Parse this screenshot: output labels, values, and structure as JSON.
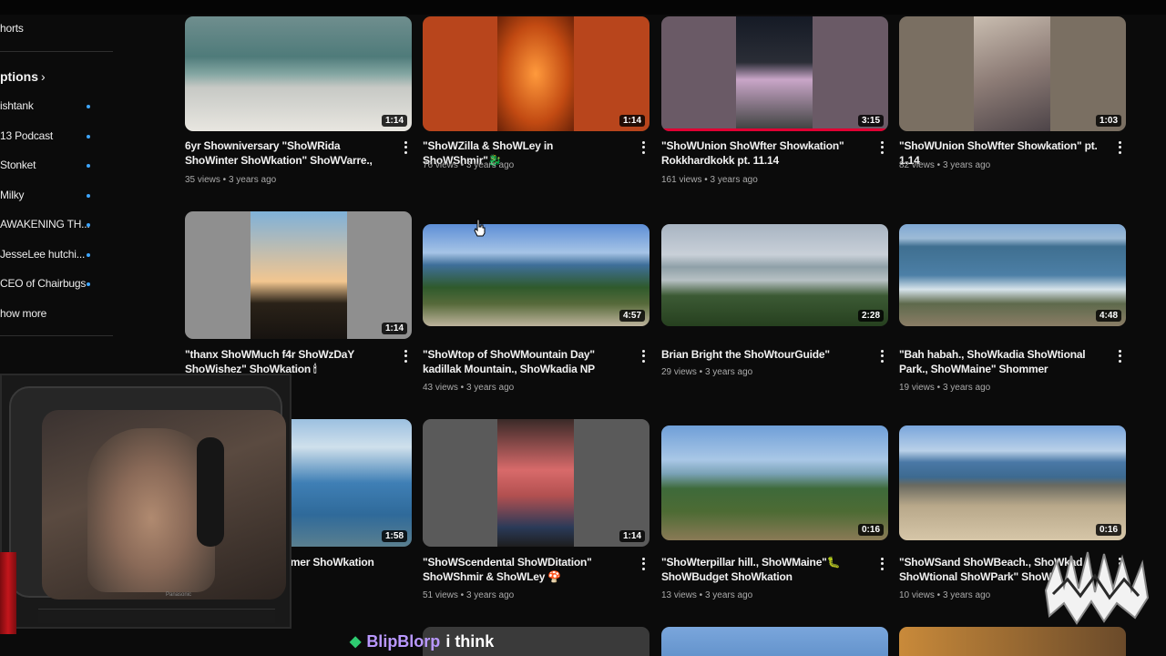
{
  "sidebar": {
    "shorts_label": "horts",
    "subscriptions_heading": "ptions",
    "channels": [
      {
        "label": "ishtank"
      },
      {
        "label": "13 Podcast"
      },
      {
        "label": "Stonket"
      },
      {
        "label": "Milky"
      },
      {
        "label": "AWAKENING TH..."
      },
      {
        "label": "JesseLee hutchi..."
      },
      {
        "label": "CEO of Chairbugs"
      }
    ],
    "show_more_label": "how more",
    "accent_color": "#3ea6ff"
  },
  "videos": [
    {
      "title": "6yr Showniversary \"ShoWRida ShoWinter ShoWkation\" ShoWVarre., ShoWBeach fM...",
      "views": "35 views",
      "age": "3 years ago",
      "duration": "1:14"
    },
    {
      "title": "\"ShoWZilla & ShoWLey in ShoWShmir\"🐉",
      "views": "76 views",
      "age": "3 years ago",
      "duration": "1:14"
    },
    {
      "title": "\"ShoWUnion ShoWfter Showkation\" Rokkhardkokk pt. 11.14",
      "views": "161 views",
      "age": "3 years ago",
      "duration": "3:15",
      "watched_fraction": 1.0
    },
    {
      "title": "\"ShoWUnion ShoWfter Showkation\" pt. 1.14",
      "views": "82 views",
      "age": "3 years ago",
      "duration": "1:03"
    },
    {
      "title": "\"thanx ShoWMuch f4r ShoWzDaY ShoWishez\" ShoWkation 🕯",
      "views": "",
      "age": "",
      "duration": "1:14"
    },
    {
      "title": "\"ShoWtop of ShoWMountain Day\" kadillak Mountain., ShoWkadia NP ShoWMaine...",
      "views": "43 views",
      "age": "3 years ago",
      "duration": "4:57"
    },
    {
      "title": "Brian Bright the ShoWtourGuide\"",
      "views": "29 views",
      "age": "3 years ago",
      "duration": "2:28"
    },
    {
      "title": "\"Bah habah., ShoWkadia ShoWtional Park., ShoWMaine\" Shommer ShoWkation fMMS...",
      "views": "19 views",
      "age": "3 years ago",
      "duration": "4:48"
    },
    {
      "title": "l P.rk., ShoWMaine mmer ShoWkation",
      "views": "",
      "age": "",
      "duration": "1:58"
    },
    {
      "title": "\"ShoWScendental ShoWDitation\" ShoWShmir & ShoWLey 🍄",
      "views": "51 views",
      "age": "3 years ago",
      "duration": "1:14"
    },
    {
      "title": "\"ShoWterpillar hill., ShoWMaine\"🐛 ShoWBudget ShoWkation",
      "views": "13 views",
      "age": "3 years ago",
      "duration": "0:16"
    },
    {
      "title": "\"ShoWSand ShoWBeach., ShoWkad ShoWtional ShoWPark\" ShoWE",
      "views": "10 views",
      "age": "3 years ago",
      "duration": "0:16"
    }
  ],
  "overlay": {
    "tv_brand": "Panasonic",
    "chat_user": "BlipBlorp",
    "chat_message": "i think",
    "chat_user_color": "#b998ff"
  }
}
